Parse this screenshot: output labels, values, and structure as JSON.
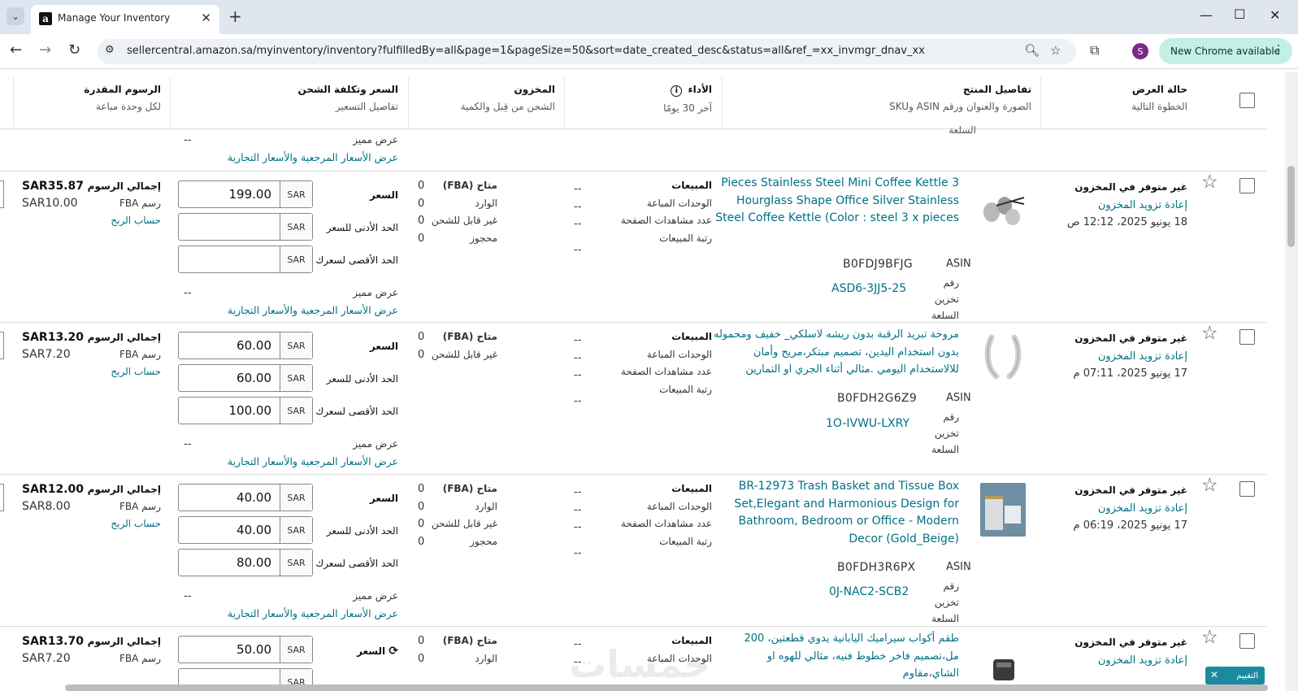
{
  "browser": {
    "tab_title": "Manage Your Inventory",
    "url": "sellercentral.amazon.sa/myinventory/inventory?fulfilledBy=all&page=1&pageSize=50&sort=date_created_desc&status=all&ref_=xx_invmgr_dnav_xx",
    "profile_initial": "S",
    "update_label": "New Chrome available"
  },
  "table": {
    "headers": {
      "status": {
        "main": "حالة العرض",
        "sub": "الخطوة التالية"
      },
      "product": {
        "main": "تفاصيل المنتج",
        "sub": "الصورة والعنوان ورقم ASIN وSKU"
      },
      "performance": {
        "main": "الأداء",
        "sub": "آخر 30 يومًا"
      },
      "inventory": {
        "main": "المخزون",
        "sub": "الشحن من قِبل والكمية"
      },
      "price": {
        "main": "السعر وتكلفة الشحن",
        "sub": "تفاصيل التسعير"
      },
      "fees": {
        "main": "الرسوم المقدرة",
        "sub": "لكل وحدة مباعة"
      }
    },
    "fragment": {
      "sku_label_tail": "السلعة",
      "featured_label": "عرض مميز",
      "featured_value": "--",
      "reference_link": "عرض الأسعار المرجعية والأسعار التجارية"
    },
    "labels": {
      "asin": "ASIN",
      "sku": "رقم تخزين السلعة",
      "sales": "المبيعات",
      "units_sold": "الوحدات المباعة",
      "page_views": "عدد مشاهدات الصفحة",
      "sales_rank": "رتبة المبيعات",
      "fba_available": "متاح (FBA)",
      "inbound": "الوارد",
      "unfulfillable": "غير قابل للشحن",
      "reserved": "محجوز",
      "price": "السعر",
      "min_price": "الحد الأدنى للسعر",
      "max_price": "الحد الأقصى لسعرك",
      "featured_offer": "عرض مميز",
      "reference_prices": "عرض الأسعار المرجعية والأسعار التجارية",
      "currency": "SAR",
      "total_fees": "إجمالي الرسوم",
      "fba_fee": "رسم FBA",
      "profit_calc": "حساب الربح",
      "dash": "--"
    },
    "rows": [
      {
        "status": "غير متوفر في المخزون",
        "action": "إعادة تزويد المخزون",
        "date": "18 يونيو 2025، 12:12 ص",
        "title": "3  Pieces Stainless Steel Mini Coffee Kettle Hourglass Shape Office Silver Stainless Steel Coffee Kettle (Color : steel 3 x pieces",
        "asin": "B0FDJ9BFJG",
        "sku": "ASD6-3JJ5-25",
        "price": "199.00",
        "min_price": "",
        "max_price": "",
        "inventory": [
          "0",
          "0",
          "0",
          "0"
        ],
        "total_fee": "SAR35.87",
        "fba_fee": "SAR10.00",
        "thumb_kind": "kettles"
      },
      {
        "status": "غير متوفر في المخزون",
        "action": "إعادة تزويد المخزون",
        "date": "17 يونيو 2025، 07:11 م",
        "title": "مروحة تبريد الرقبة بدون ريشه لاسلكي_ خفيف ومحموله بدون استخدام اليدين، تصميم مبتكر،مريح وأمان للالاستخدام اليومي .مثالي أثناء الجري او التمارين",
        "asin": "B0FDH2G6Z9",
        "sku": "1O-IVWU-LXRY",
        "price": "60.00",
        "min_price": "60.00",
        "max_price": "100.00",
        "inventory": [
          "0",
          "0"
        ],
        "total_fee": "SAR13.20",
        "fba_fee": "SAR7.20",
        "thumb_kind": "fan"
      },
      {
        "status": "غير متوفر في المخزون",
        "action": "إعادة تزويد المخزون",
        "date": "17 يونيو 2025، 06:19 م",
        "title": "BR-12973 Trash Basket and Tissue Box Set,Elegant and Harmonious Design for Bathroom, Bedroom or Office - Modern Decor (Gold_Beige)",
        "asin": "B0FDH3R6PX",
        "sku": "0J-NAC2-SCB2",
        "price": "40.00",
        "min_price": "40.00",
        "max_price": "80.00",
        "inventory": [
          "0",
          "0",
          "0",
          "0"
        ],
        "total_fee": "SAR12.00",
        "fba_fee": "SAR8.00",
        "thumb_kind": "basket"
      },
      {
        "status": "غير متوفر في المخزون",
        "action": "إعادة تزويد المخزون",
        "title": "طقم أكواب سيراميك اليابانية يدوي قطعتين، 200 مل،تصميم فاخر خطوط فنيه، مثالي للهوه او الشاي،مقاوم",
        "price": "50.00",
        "inventory": [
          "0",
          "0"
        ],
        "total_fee": "SAR13.70",
        "fba_fee": "SAR7.20",
        "thumb_kind": "cups"
      }
    ]
  },
  "feedback_button": "التقييم",
  "watermark": "خمسات"
}
